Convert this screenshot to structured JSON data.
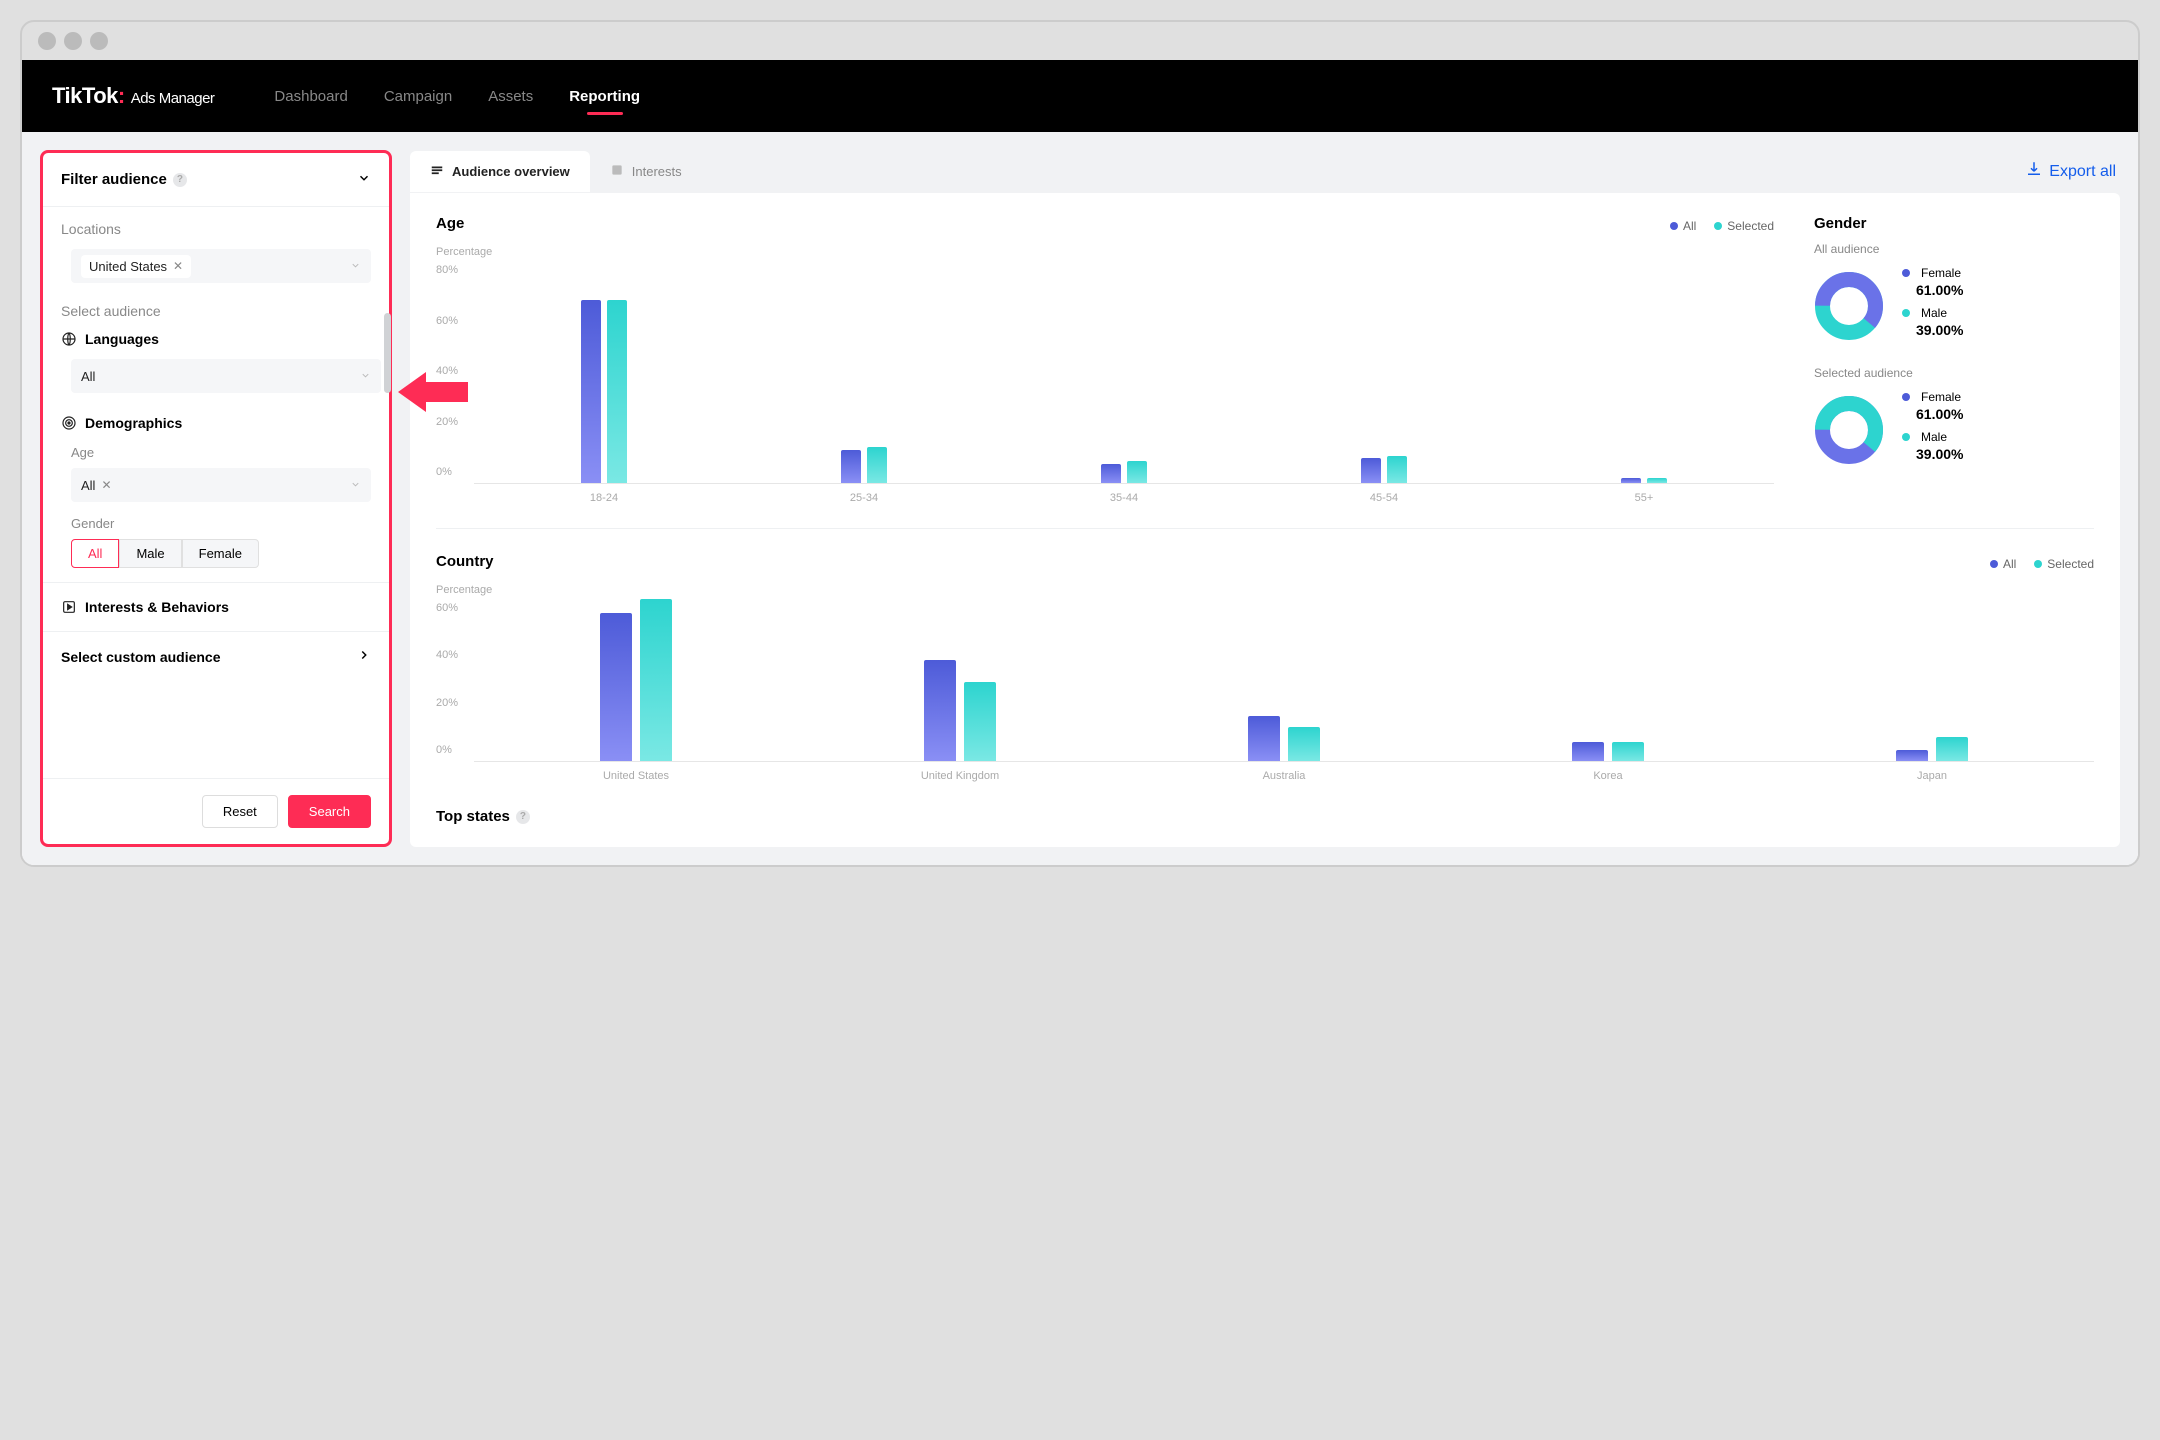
{
  "brand": {
    "name": "TikTok",
    "sub": "Ads Manager"
  },
  "nav": {
    "items": [
      "Dashboard",
      "Campaign",
      "Assets",
      "Reporting"
    ],
    "active": 3
  },
  "sidebar": {
    "title": "Filter audience",
    "locations": {
      "label": "Locations",
      "value": "United States"
    },
    "select_audience_label": "Select audience",
    "languages": {
      "label": "Languages",
      "value": "All"
    },
    "demographics": {
      "label": "Demographics",
      "age_label": "Age",
      "age_value": "All",
      "gender_label": "Gender",
      "gender_options": [
        "All",
        "Male",
        "Female"
      ],
      "gender_active": 0
    },
    "interests_label": "Interests & Behaviors",
    "custom_label": "Select custom audience",
    "reset": "Reset",
    "search": "Search"
  },
  "tabs": {
    "items": [
      "Audience overview",
      "Interests"
    ],
    "active": 0
  },
  "export_label": "Export all",
  "age": {
    "title": "Age",
    "ylabel": "Percentage",
    "legend": [
      "All",
      "Selected"
    ]
  },
  "gender": {
    "title": "Gender",
    "all_label": "All audience",
    "sel_label": "Selected audience",
    "female_label": "Female",
    "male_label": "Male",
    "female_pct": "61.00%",
    "male_pct": "39.00%"
  },
  "country": {
    "title": "Country",
    "ylabel": "Percentage",
    "legend": [
      "All",
      "Selected"
    ]
  },
  "top_states_label": "Top states",
  "chart_data": [
    {
      "type": "bar",
      "title": "Age",
      "ylabel": "Percentage",
      "ylim": [
        0,
        80
      ],
      "categories": [
        "18-24",
        "25-34",
        "35-44",
        "45-54",
        "55+"
      ],
      "series": [
        {
          "name": "All",
          "values": [
            67,
            12,
            7,
            9,
            2
          ]
        },
        {
          "name": "Selected",
          "values": [
            67,
            13,
            8,
            10,
            2
          ]
        }
      ]
    },
    {
      "type": "pie",
      "title": "Gender — All audience",
      "categories": [
        "Female",
        "Male"
      ],
      "values": [
        61,
        39
      ]
    },
    {
      "type": "pie",
      "title": "Gender — Selected audience",
      "categories": [
        "Female",
        "Male"
      ],
      "values": [
        61,
        39
      ]
    },
    {
      "type": "bar",
      "title": "Country",
      "ylabel": "Percentage",
      "ylim": [
        0,
        60
      ],
      "categories": [
        "United States",
        "United Kingdom",
        "Australia",
        "Korea",
        "Japan"
      ],
      "series": [
        {
          "name": "All",
          "values": [
            56,
            38,
            17,
            7,
            4
          ]
        },
        {
          "name": "Selected",
          "values": [
            61,
            30,
            13,
            7,
            9
          ]
        }
      ]
    }
  ]
}
